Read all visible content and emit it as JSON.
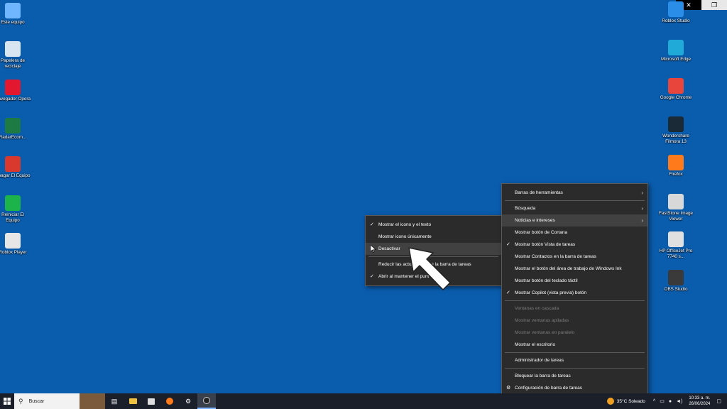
{
  "window_controls": {
    "close": "✕",
    "restore": "❐"
  },
  "desktop_left": [
    {
      "label": "Este equipo",
      "icon": "computer-icon",
      "color": "#6fb6ff"
    },
    {
      "label": "Papelera de reciclaje",
      "icon": "recycle-bin-icon",
      "color": "#d9e6f2"
    },
    {
      "label": "Navegador Opera",
      "icon": "opera-icon",
      "color": "#e3172d"
    },
    {
      "label": "RadarEcom...",
      "icon": "excel-icon",
      "color": "#1e7a43"
    },
    {
      "label": "Apagar El Equipo",
      "icon": "power-icon",
      "color": "#d9382c"
    },
    {
      "label": "Reiniciar El Equipo",
      "icon": "green-arrow-icon",
      "color": "#1bb34a"
    },
    {
      "label": "Roblox Player",
      "icon": "roblox-icon",
      "color": "#e6e6e6"
    }
  ],
  "desktop_right": [
    {
      "label": "Roblox Studio",
      "icon": "roblox-studio-icon",
      "color": "#2a8ee8"
    },
    {
      "label": "Microsoft Edge",
      "icon": "edge-icon",
      "color": "#1faad8"
    },
    {
      "label": "Google Chrome",
      "icon": "chrome-icon",
      "color": "#e8453c"
    },
    {
      "label": "Wondershare Filmora 13",
      "icon": "filmora-icon",
      "color": "#1a2a36"
    },
    {
      "label": "Firefox",
      "icon": "firefox-icon",
      "color": "#ff7a1a"
    },
    {
      "label": "FastStone Image Viewer",
      "icon": "faststone-icon",
      "color": "#d8d8d8"
    },
    {
      "label": "HP OfficeJet Pro 7740 s...",
      "icon": "printer-icon",
      "color": "#e0e0e0"
    },
    {
      "label": "OBS Studio",
      "icon": "obs-icon",
      "color": "#3a3a3a"
    }
  ],
  "submenu": {
    "items": [
      {
        "label": "Mostrar el icono y el texto",
        "checked": true
      },
      {
        "label": "Mostrar icono únicamente",
        "checked": false
      },
      {
        "label": "Desactivar",
        "checked": false,
        "highlighted": true
      },
      {
        "label": "Reducir las actua",
        "suffix": "e la barra de tareas",
        "checked": false
      },
      {
        "label": "Abrir al mantener el punt",
        "checked": true
      }
    ]
  },
  "context_menu": {
    "items": [
      {
        "label": "Barras de herramientas",
        "arrow": true
      },
      {
        "label": "Búsqueda",
        "arrow": true
      },
      {
        "label": "Noticias e intereses",
        "arrow": true,
        "highlighted": true
      },
      {
        "label": "Mostrar botón de Cortana"
      },
      {
        "label": "Mostrar botón Vista de tareas",
        "checked": true
      },
      {
        "label": "Mostrar Contactos en la barra de tareas"
      },
      {
        "label": "Mostrar el botón del área de trabajo de Windows Ink"
      },
      {
        "label": "Mostrar botón del teclado táctil"
      },
      {
        "label": "Mostrar Copilot (vista previa) botón",
        "checked": true
      },
      {
        "label": "Ventanas en cascada",
        "disabled": true
      },
      {
        "label": "Mostrar ventanas apiladas",
        "disabled": true
      },
      {
        "label": "Mostrar ventanas en paralelo",
        "disabled": true
      },
      {
        "label": "Mostrar el escritorio"
      },
      {
        "label": "Administrador de tareas"
      },
      {
        "label": "Bloquear la barra de tareas"
      },
      {
        "label": "Configuración de barra de tareas",
        "gear": true
      }
    ]
  },
  "taskbar": {
    "search_placeholder": "Buscar",
    "weather": "35°C  Soleado",
    "time": "10:33 a. m.",
    "date": "26/06/2024"
  }
}
